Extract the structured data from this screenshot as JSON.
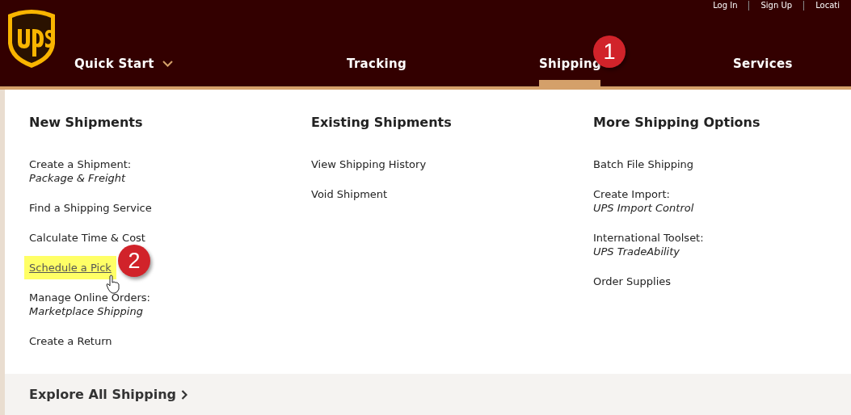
{
  "utility_links": [
    "Log In",
    "Sign Up",
    "Locati"
  ],
  "nav": [
    {
      "label": "Quick Start",
      "selected": false,
      "dropdown": true
    },
    {
      "label": "Tracking",
      "selected": false,
      "dropdown": false
    },
    {
      "label": "Shipping",
      "selected": true,
      "dropdown": false
    },
    {
      "label": "Services",
      "selected": false,
      "dropdown": false
    }
  ],
  "columns": [
    {
      "heading": "New Shipments",
      "items": [
        {
          "label": "Create a Shipment:",
          "subtitle": "Package & Freight",
          "highlighted": false
        },
        {
          "label": "Find a Shipping Service",
          "highlighted": false
        },
        {
          "label": "Calculate Time & Cost",
          "highlighted": false
        },
        {
          "label": "Schedule a Pick",
          "highlighted": true
        },
        {
          "label": "Manage Online Orders:",
          "subtitle": "Marketplace Shipping",
          "highlighted": false
        },
        {
          "label": "Create a Return",
          "highlighted": false
        }
      ]
    },
    {
      "heading": "Existing Shipments",
      "items": [
        {
          "label": "View Shipping History",
          "highlighted": false
        },
        {
          "label": "Void Shipment",
          "highlighted": false
        }
      ]
    },
    {
      "heading": "More Shipping Options",
      "items": [
        {
          "label": "Batch File Shipping",
          "highlighted": false
        },
        {
          "label": "Create Import:",
          "subtitle": "UPS Import Control",
          "highlighted": false
        },
        {
          "label": "International Toolset:",
          "subtitle": "UPS TradeAbility",
          "highlighted": false
        },
        {
          "label": "Order Supplies",
          "highlighted": false
        }
      ]
    }
  ],
  "footer_link": "Explore All Shipping",
  "annotations": [
    "1",
    "2"
  ]
}
